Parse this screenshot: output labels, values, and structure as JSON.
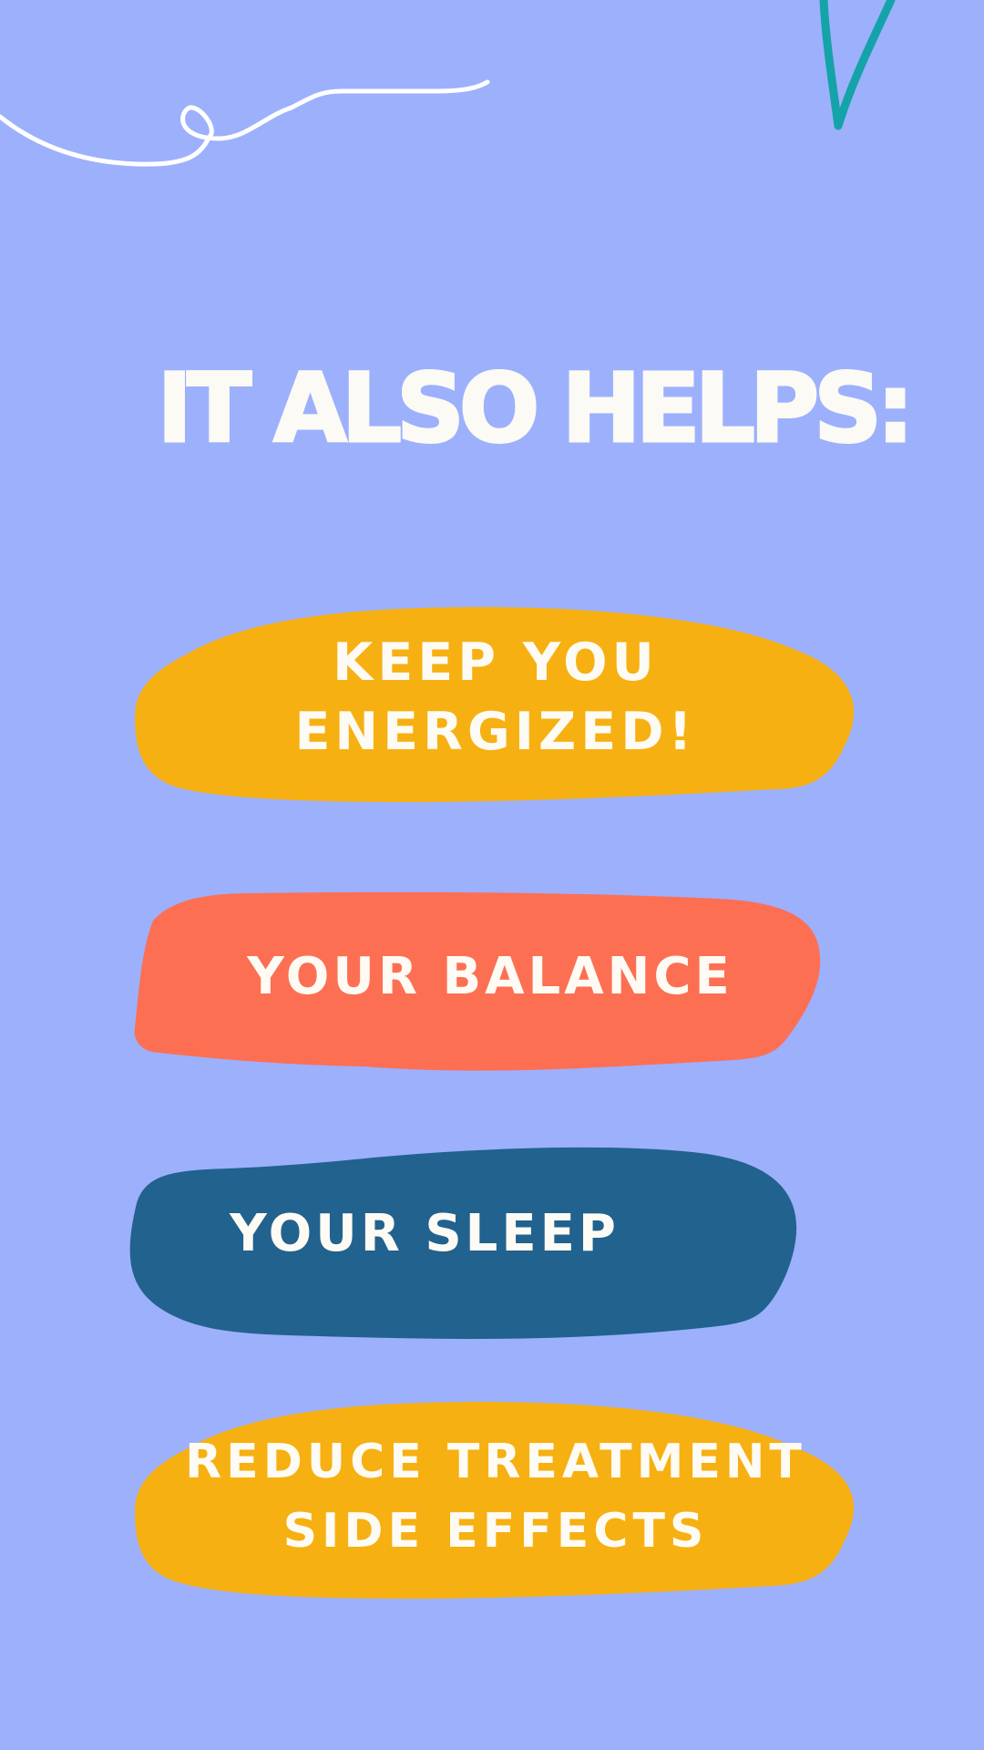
{
  "heading": "IT ALSO HELPS:",
  "benefits": [
    {
      "label": "KEEP YOU ENERGIZED!",
      "color": "#f6b012"
    },
    {
      "label": "YOUR BALANCE",
      "color": "#fd6f53"
    },
    {
      "label": "YOUR SLEEP",
      "color": "#21628f"
    },
    {
      "label": "REDUCE TREATMENT SIDE EFFECTS",
      "color": "#f6b012"
    }
  ],
  "colors": {
    "background": "#9db0fc",
    "text": "#fbfaf5",
    "swirl": "#ffffff",
    "accent_stroke": "#14a3a8"
  },
  "decorations": [
    "white-swirl-line",
    "teal-v-stroke"
  ]
}
